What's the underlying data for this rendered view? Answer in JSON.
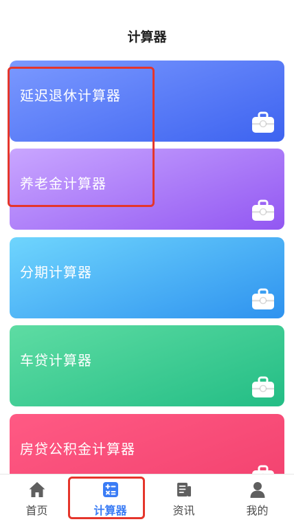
{
  "header": {
    "title": "计算器"
  },
  "cards": [
    {
      "label": "延迟退休计算器",
      "icon": "briefcase-icon"
    },
    {
      "label": "养老金计算器",
      "icon": "briefcase-icon"
    },
    {
      "label": "分期计算器",
      "icon": "briefcase-icon"
    },
    {
      "label": "车贷计算器",
      "icon": "briefcase-icon"
    },
    {
      "label": "房贷公积金计算器",
      "icon": "briefcase-icon"
    }
  ],
  "tabbar": {
    "items": [
      {
        "label": "首页",
        "icon": "home-icon",
        "active": false
      },
      {
        "label": "计算器",
        "icon": "calculator-icon",
        "active": true
      },
      {
        "label": "资讯",
        "icon": "news-icon",
        "active": false
      },
      {
        "label": "我的",
        "icon": "user-icon",
        "active": false
      }
    ]
  },
  "colors": {
    "active_tab": "#3a7cf5",
    "inactive_tab": "#4a4a4a",
    "highlight_border": "#e5352b",
    "card_gradients": [
      [
        "#7b99ff",
        "#3d63f0"
      ],
      [
        "#c9a6ff",
        "#9257f2"
      ],
      [
        "#6fd5fd",
        "#2e92ef"
      ],
      [
        "#5edca3",
        "#23bd85"
      ],
      [
        "#ff5a84",
        "#f2416e"
      ]
    ]
  }
}
